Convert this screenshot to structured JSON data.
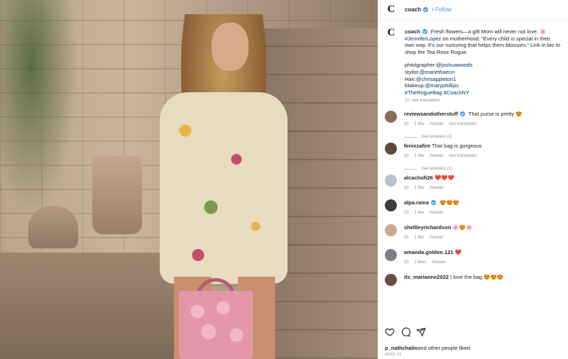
{
  "header": {
    "logo": "C",
    "username": "coach",
    "separator": "•",
    "follow_label": "Follow"
  },
  "caption": {
    "logo": "C",
    "username": "coach",
    "line1": " Fresh flowers—a gift Mom will never not love. ",
    "line1_emoji": "🌸",
    "mention": "#JenniferLopez",
    "line2": " on motherhood: \"Every child is special in their own way. It's our nurturing that helps them blossom.\" Link in bio to shop the Tea Rose Rogue.",
    "credits": [
      {
        "label": "phtolgrapher:",
        "handle": "@joshuawoods"
      },
      {
        "label": "stylist:",
        "handle": "@mariethaenn"
      },
      {
        "label": "Hair:",
        "handle": "@chrisappleton1"
      },
      {
        "label": "Makeup:",
        "handle": "@maryphillips"
      }
    ],
    "hashtags": "#TheRogueBag #CoachNY",
    "time": "1h",
    "see_translation": "see translation"
  },
  "comments": [
    {
      "username": "reviewsandotherstuff",
      "verified": true,
      "text": " That purse is pretty 😍",
      "time": "1h",
      "likes": "1 like",
      "answer": "Answer",
      "translation": "see translation",
      "see_answers": "See answers (2)",
      "avatar_color": "#8a6d5b"
    },
    {
      "username": "fenixzafire",
      "verified": false,
      "text": " That bag is gorgeous",
      "time": "1h",
      "likes": "1 like",
      "answer": "Answer",
      "translation": "see translation",
      "see_answers": "See answers (1)",
      "avatar_color": "#5e4a3d"
    },
    {
      "username": "alcachofi26",
      "verified": false,
      "text": " ❤️❤️❤️",
      "time": "1h",
      "likes": "1 like",
      "answer": "Answer",
      "translation": "",
      "see_answers": "",
      "avatar_color": "#b6c4cf"
    },
    {
      "username": "alpa.rama",
      "verified": true,
      "text": " 😍😍😍",
      "time": "1h",
      "likes": "1 like",
      "answer": "Answer",
      "translation": "",
      "see_answers": "",
      "avatar_color": "#3b3b3b"
    },
    {
      "username": "shellleyrichardson",
      "verified": false,
      "text": " 🌸😍🌸",
      "time": "1h",
      "likes": "1 like",
      "answer": "Answer",
      "translation": "",
      "see_answers": "",
      "avatar_color": "#c9a98e"
    },
    {
      "username": "amanda.golden.121",
      "verified": false,
      "text": " ❤️",
      "time": "1h",
      "likes": "2 likes",
      "answer": "Answer",
      "translation": "",
      "see_answers": "",
      "avatar_color": "#7d7f86"
    },
    {
      "username": "its_marianne2022",
      "verified": false,
      "text": " I love the bag 😍😍😍",
      "time": "",
      "likes": "",
      "answer": "",
      "translation": "",
      "see_answers": "",
      "avatar_color": "#6b4f43"
    }
  ],
  "actions": {
    "icons": [
      "heart-icon",
      "comment-icon",
      "share-icon"
    ]
  },
  "likes": {
    "user": "p_nathchalin",
    "rest": "and other people liked"
  },
  "date": "APRIL 15"
}
